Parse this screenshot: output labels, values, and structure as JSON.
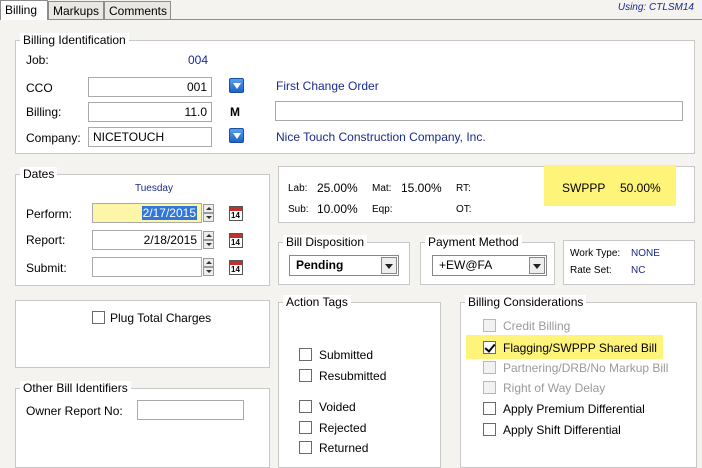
{
  "tabs": [
    {
      "label": "Billing",
      "active": true
    },
    {
      "label": "Markups",
      "active": false
    },
    {
      "label": "Comments",
      "active": false
    }
  ],
  "using": "Using: CTLSM14",
  "billing_identification": {
    "title": "Billing Identification",
    "job_label": "Job:",
    "job_value": "004",
    "cco_label": "CCO",
    "cco_value": "001",
    "cco_desc": "First Change Order",
    "billing_label": "Billing:",
    "billing_value": "11.0",
    "billing_flag": "M",
    "billing_desc": "",
    "company_label": "Company:",
    "company_value": "NICETOUCH",
    "company_desc": "Nice Touch Construction Company, Inc."
  },
  "dates": {
    "title": "Dates",
    "weekday": "Tuesday",
    "perform_label": "Perform:",
    "perform_value": "2/17/2015",
    "report_label": "Report:",
    "report_value": "2/18/2015",
    "submit_label": "Submit:",
    "submit_value": "",
    "calendar_text": "14"
  },
  "rates": {
    "lab_label": "Lab:",
    "lab_value": "25.00%",
    "mat_label": "Mat:",
    "mat_value": "15.00%",
    "rt_label": "RT:",
    "sub_label": "Sub:",
    "sub_value": "10.00%",
    "eqp_label": "Eqp:",
    "ot_label": "OT:",
    "swppp_label": "SWPPP",
    "swppp_value": "50.00%"
  },
  "bill_disposition": {
    "title": "Bill Disposition",
    "value": "Pending"
  },
  "payment_method": {
    "title": "Payment Method",
    "value": "+EW@FA"
  },
  "work_info": {
    "work_type_label": "Work Type:",
    "work_type_value": "NONE",
    "rate_set_label": "Rate Set:",
    "rate_set_value": "NC"
  },
  "plug_total_charges": {
    "label": "Plug Total Charges",
    "checked": false
  },
  "action_tags": {
    "title": "Action Tags",
    "items": [
      {
        "label": "Submitted",
        "checked": false
      },
      {
        "label": "Resubmitted",
        "checked": false
      },
      {
        "label": "Voided",
        "checked": false
      },
      {
        "label": "Rejected",
        "checked": false
      },
      {
        "label": "Returned",
        "checked": false
      }
    ]
  },
  "billing_considerations": {
    "title": "Billing Considerations",
    "items": [
      {
        "label": "Credit Billing",
        "checked": false,
        "disabled": true
      },
      {
        "label": "Flagging/SWPPP Shared Bill",
        "checked": true,
        "disabled": false
      },
      {
        "label": "Partnering/DRB/No Markup Bill",
        "checked": false,
        "disabled": true
      },
      {
        "label": "Right of Way Delay",
        "checked": false,
        "disabled": true
      },
      {
        "label": "Apply Premium Differential",
        "checked": false,
        "disabled": false
      },
      {
        "label": "Apply Shift Differential",
        "checked": false,
        "disabled": false
      }
    ]
  },
  "other_bill_identifiers": {
    "title": "Other Bill Identifiers",
    "owner_report_label": "Owner Report No:",
    "owner_report_value": ""
  },
  "colors": {
    "highlight": "#fff47a",
    "link_blue": "#1a2b8c"
  }
}
